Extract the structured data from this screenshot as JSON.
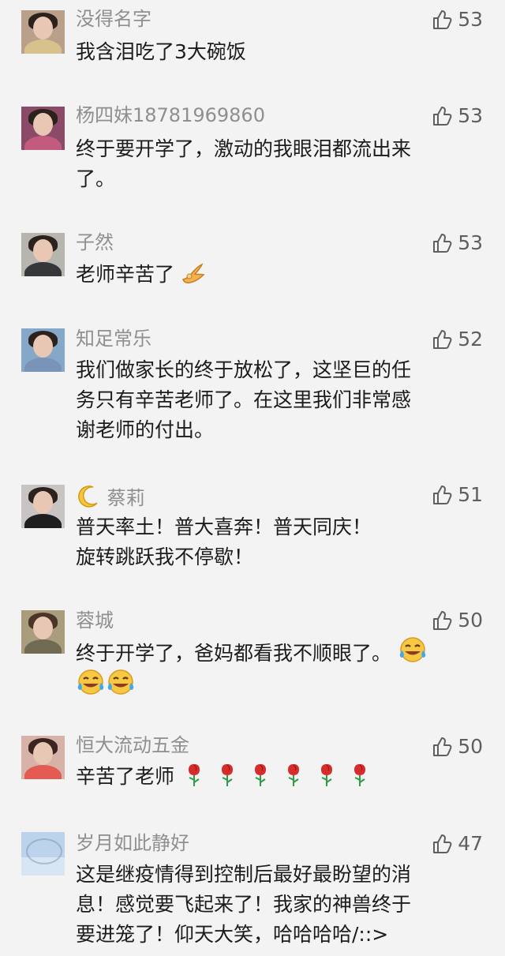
{
  "comments": [
    {
      "user": "没得名字",
      "likes": "53",
      "lines": [
        "我含泪吃了3大碗饭"
      ]
    },
    {
      "user": "杨四妹18781969860",
      "likes": "53",
      "lines": [
        "终于要开学了，激动的我眼泪都流出来",
        "了。"
      ]
    },
    {
      "user": "子然",
      "likes": "53",
      "lines": [
        "老师辛苦了"
      ]
    },
    {
      "user": "知足常乐",
      "likes": "52",
      "lines": [
        "我们做家长的终于放松了，这坚巨的任",
        "务只有辛苦老师了。在这里我们非常感",
        "谢老师的付出。"
      ]
    },
    {
      "user": "蔡莉",
      "likes": "51",
      "lines": [
        "普天率土！普大喜奔！普天同庆！",
        "旋转跳跃我不停歇！"
      ]
    },
    {
      "user": "蓉城",
      "likes": "50",
      "lines": [
        "终于开学了，爸妈都看我不顺眼了。"
      ]
    },
    {
      "user": "恒大流动五金",
      "likes": "50",
      "lines": [
        "辛苦了老师"
      ]
    },
    {
      "user": "岁月如此静好",
      "likes": "47",
      "lines": [
        "这是继疫情得到控制后最好最盼望的消",
        "息！感觉要飞起来了！我家的神兽终于",
        "要进笼了！仰天大笑，哈哈哈哈/::>"
      ]
    }
  ],
  "icons": {
    "like": "thumbs-up-icon",
    "ok_hand": "ok-hand-emoji",
    "moon": "crescent-moon-emoji",
    "laugh": "tears-of-joy-emoji",
    "rose": "rose-emoji"
  },
  "colors": {
    "background": "#f3f3f3",
    "username": "#8f8f8f",
    "text": "#1c1c1c",
    "likes": "#5f5f5f"
  }
}
